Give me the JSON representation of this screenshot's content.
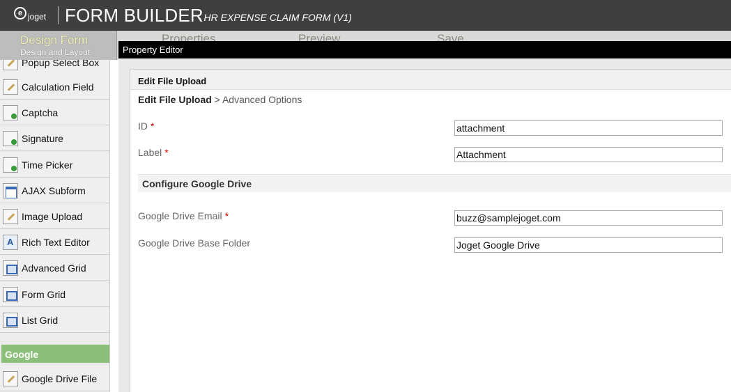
{
  "header": {
    "logo_text": "joget",
    "title": "FORM BUILDER",
    "subtitle": "- HR EXPENSE CLAIM FORM (V1)"
  },
  "tabs": {
    "active_label": "Design Form",
    "active_sublabel": "Design and Layout",
    "others": [
      "Properties",
      "Preview",
      "Save"
    ]
  },
  "sidebar": {
    "items": [
      {
        "label": "Popup Select Box",
        "icon": "pencil-field-icon"
      },
      {
        "label": "Calculation Field",
        "icon": "pencil-field-icon"
      },
      {
        "label": "Captcha",
        "icon": "field-dot-icon"
      },
      {
        "label": "Signature",
        "icon": "field-dot-icon"
      },
      {
        "label": "Time Picker",
        "icon": "field-dot-icon"
      },
      {
        "label": "AJAX Subform",
        "icon": "window-icon"
      },
      {
        "label": "Image Upload",
        "icon": "pencil-field-icon"
      },
      {
        "label": "Rich Text Editor",
        "icon": "rich-text-icon"
      },
      {
        "label": "Advanced Grid",
        "icon": "grid-icon"
      },
      {
        "label": "Form Grid",
        "icon": "grid-icon"
      },
      {
        "label": "List Grid",
        "icon": "grid-icon"
      }
    ],
    "group_label": "Google",
    "group_items": [
      {
        "label": "Google Drive File",
        "icon": "pencil-field-icon"
      }
    ]
  },
  "editor": {
    "bar_title": "Property Editor",
    "panel_title": "Edit File Upload",
    "breadcrumb_root": "Edit File Upload",
    "breadcrumb_rest": " > Advanced Options",
    "fields": [
      {
        "label": "ID",
        "required": true,
        "value": "attachment"
      },
      {
        "label": "Label",
        "required": true,
        "value": "Attachment"
      }
    ],
    "section_title": "Configure Google Drive",
    "section_fields": [
      {
        "label": "Google Drive Email",
        "required": true,
        "value": "buzz@samplejoget.com"
      },
      {
        "label": "Google Drive Base Folder",
        "required": false,
        "value": "Joget Google Drive"
      }
    ],
    "required_mark": "*"
  },
  "colors": {
    "header_bg": "#3f3f3f",
    "group_bg": "#8bbf7a",
    "required": "#d40000"
  }
}
